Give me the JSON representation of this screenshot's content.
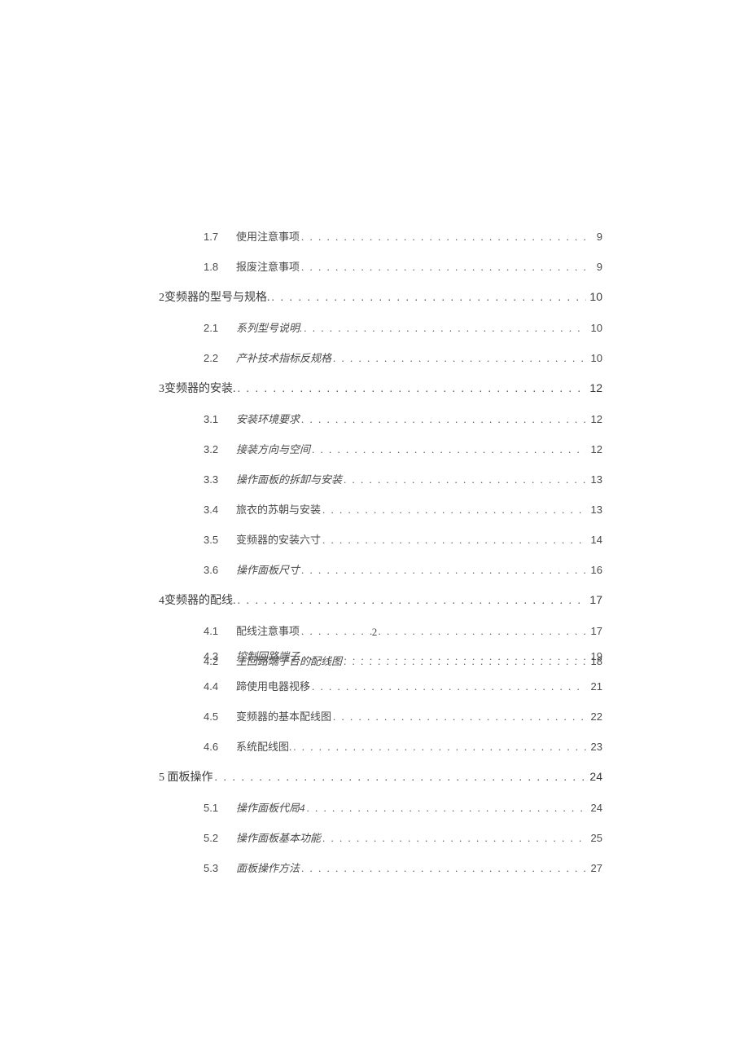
{
  "page_number": "2",
  "toc": [
    {
      "level": "sub",
      "num": "1.7",
      "title": "使用注意事项",
      "italic": false,
      "page": "9"
    },
    {
      "level": "sub",
      "num": "1.8",
      "title": "报废注意事项",
      "italic": false,
      "page": "9"
    },
    {
      "level": "section",
      "num": "2",
      "title": "变频器的型号与规格.",
      "italic": false,
      "page": "10"
    },
    {
      "level": "sub",
      "num": "2.1",
      "title": "系列型号说明.",
      "italic": true,
      "page": "10"
    },
    {
      "level": "sub",
      "num": "2.2",
      "title": "产补技术指标反规格",
      "italic": true,
      "page": "10"
    },
    {
      "level": "section",
      "num": "3",
      "title": "变频器的安装.",
      "italic": false,
      "page": "12"
    },
    {
      "level": "sub",
      "num": "3.1",
      "title": "安装环境要求",
      "italic": true,
      "page": "12"
    },
    {
      "level": "sub",
      "num": "3.2",
      "title": "接装方向与空间",
      "italic": true,
      "page": "12"
    },
    {
      "level": "sub",
      "num": "3.3",
      "title": "操作面板的拆卸与安装",
      "italic": true,
      "page": "13"
    },
    {
      "level": "sub",
      "num": "3.4",
      "title": "旅衣的苏朝与安装",
      "italic": false,
      "page": "13"
    },
    {
      "level": "sub",
      "num": "3.5",
      "title": "变频器的安装六寸",
      "italic": false,
      "page": "14"
    },
    {
      "level": "sub",
      "num": "3.6",
      "title": "操作面板尺寸",
      "italic": true,
      "page": "16"
    },
    {
      "level": "section",
      "num": "4",
      "title": "变频器的配线.",
      "italic": false,
      "page": "17"
    },
    {
      "level": "sub",
      "num": "4.1",
      "title": "配线注意事项",
      "italic": false,
      "page": "17"
    },
    {
      "level": "sub",
      "num": "4.2",
      "title": "主回路端子台的配线图",
      "italic": true,
      "page": "18"
    }
  ],
  "toc2": [
    {
      "level": "sub",
      "num": "4.3",
      "title": "控制回路端子",
      "italic": true,
      "page": "19"
    },
    {
      "level": "sub",
      "num": "4.4",
      "title": "蹄使用电器视移",
      "italic": false,
      "page": "21"
    },
    {
      "level": "sub",
      "num": "4.5",
      "title": "变频器的基本配线图",
      "italic": false,
      "page": "22"
    },
    {
      "level": "sub",
      "num": "4.6",
      "title": "系统配线图.",
      "italic": false,
      "page": "23"
    },
    {
      "level": "section",
      "num": "5",
      "title": "   面板操作",
      "italic": false,
      "page": "24"
    },
    {
      "level": "sub",
      "num": "5.1",
      "title": "操作面板代局4",
      "italic": true,
      "page": "24"
    },
    {
      "level": "sub",
      "num": "5.2",
      "title": "操作面板基本功能",
      "italic": true,
      "page": "25"
    },
    {
      "level": "sub",
      "num": "5.3",
      "title": "面板操作方法",
      "italic": true,
      "page": "27"
    }
  ]
}
